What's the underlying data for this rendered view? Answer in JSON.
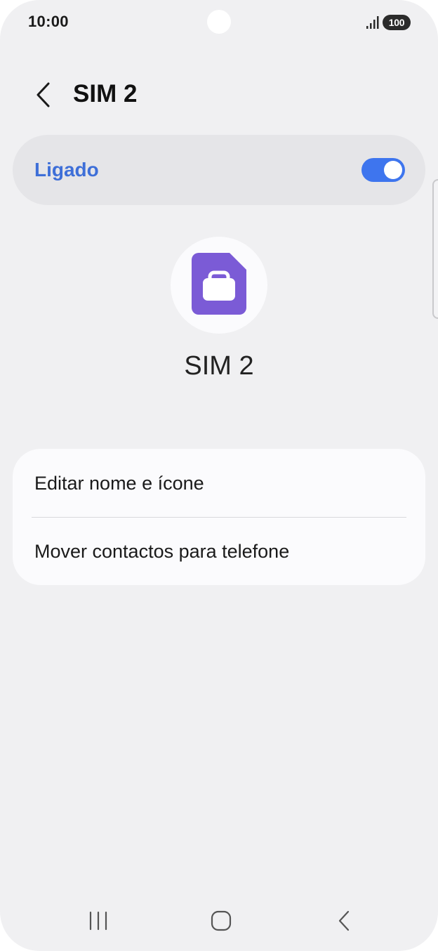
{
  "status_bar": {
    "time": "10:00",
    "battery": "100",
    "signal_icon": "signal-bars-icon"
  },
  "header": {
    "back_icon": "chevron-left-icon",
    "title": "SIM 2"
  },
  "master_switch": {
    "label": "Ligado",
    "state": "on",
    "accent_color": "#3e75ee",
    "label_color": "#3e6fd8"
  },
  "sim": {
    "icon": "sim-card-briefcase-icon",
    "icon_color": "#7b5bd6",
    "name": "SIM 2"
  },
  "options": [
    {
      "label": "Editar nome e ícone"
    },
    {
      "label": "Mover contactos para telefone"
    }
  ],
  "nav_bar": {
    "recents_icon": "recents-icon",
    "home_icon": "home-icon",
    "back_icon": "back-icon"
  }
}
